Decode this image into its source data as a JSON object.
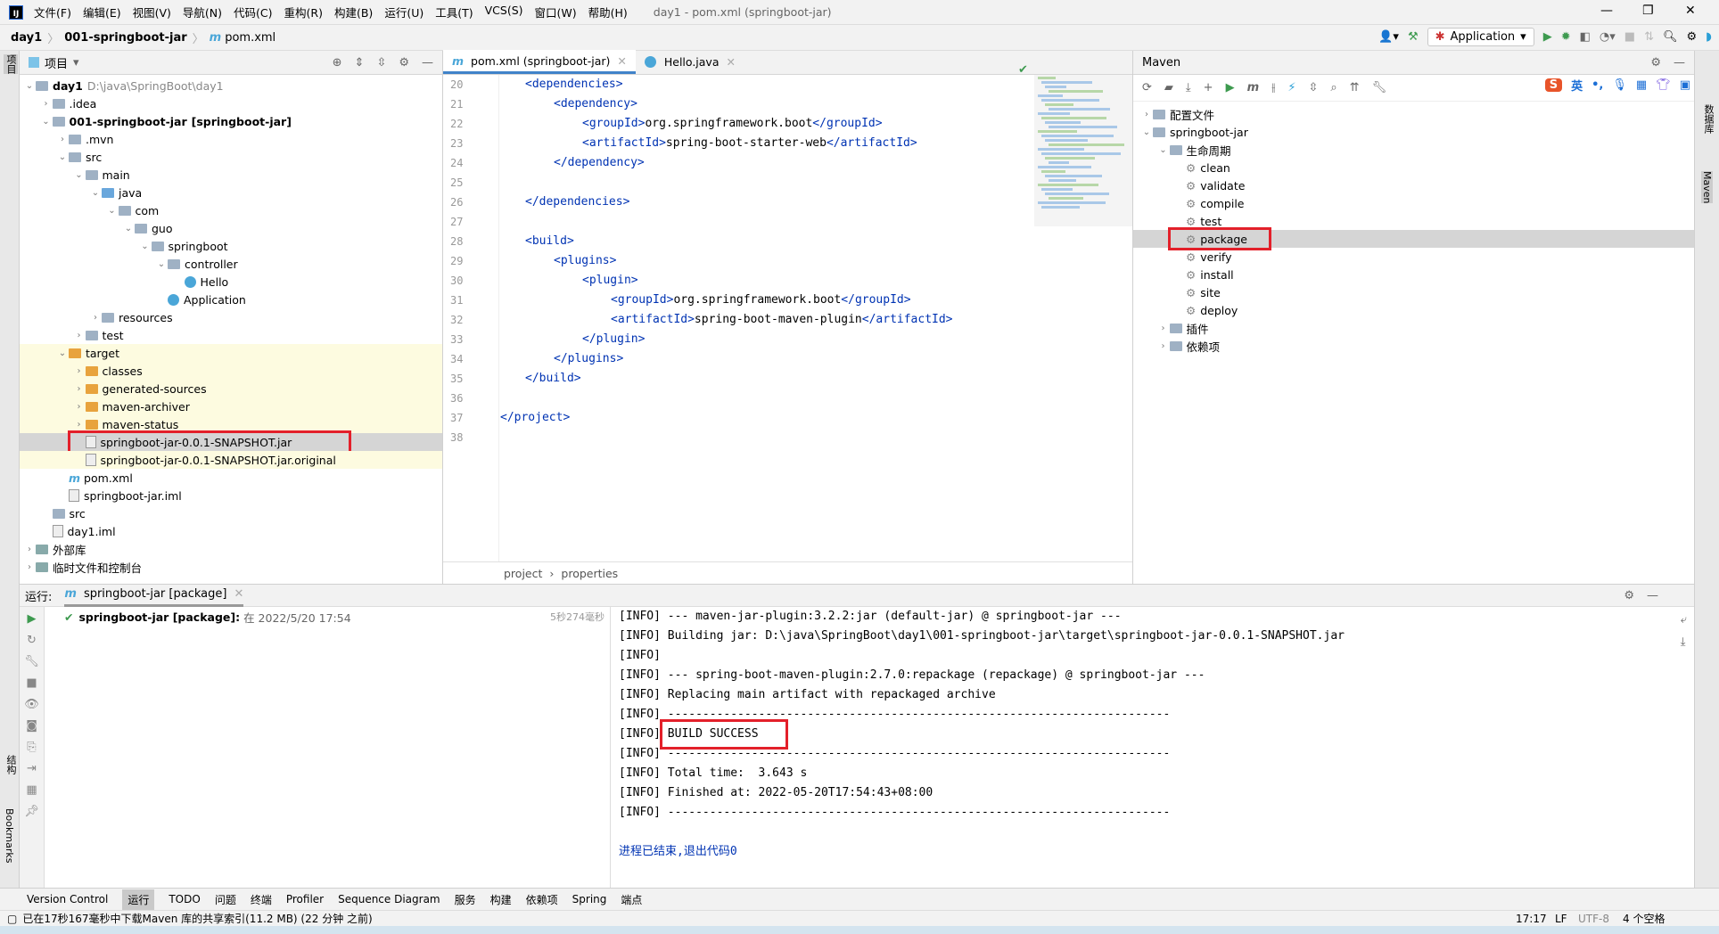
{
  "title_bar": {
    "menus": [
      "文件(F)",
      "编辑(E)",
      "视图(V)",
      "导航(N)",
      "代码(C)",
      "重构(R)",
      "构建(B)",
      "运行(U)",
      "工具(T)",
      "VCS(S)",
      "窗口(W)",
      "帮助(H)"
    ],
    "window_title": "day1 - pom.xml (springboot-jar)"
  },
  "nav": {
    "breadcrumbs": [
      "day1",
      "001-springboot-jar",
      "pom.xml"
    ],
    "run_config": "Application"
  },
  "left_stripe": {
    "project_label": "项目",
    "structure_label": "结构",
    "bookmarks_label": "Bookmarks"
  },
  "right_stripe": {
    "db_label": "数据库",
    "maven_label": "Maven"
  },
  "project": {
    "title": "项目",
    "tree": [
      {
        "label": "day1",
        "extra": "D:\\java\\SpringBoot\\day1",
        "level": 0,
        "state": "open",
        "icon": "module",
        "bold": true
      },
      {
        "label": ".idea",
        "level": 1,
        "state": "closed",
        "icon": "folder"
      },
      {
        "label": "001-springboot-jar",
        "extra": "[springboot-jar]",
        "level": 1,
        "state": "open",
        "icon": "module",
        "bold": true,
        "extra_bold": true
      },
      {
        "label": ".mvn",
        "level": 2,
        "state": "closed",
        "icon": "folder"
      },
      {
        "label": "src",
        "level": 2,
        "state": "open",
        "icon": "folder"
      },
      {
        "label": "main",
        "level": 3,
        "state": "open",
        "icon": "folder"
      },
      {
        "label": "java",
        "level": 4,
        "state": "open",
        "icon": "folder-src"
      },
      {
        "label": "com",
        "level": 5,
        "state": "open",
        "icon": "package"
      },
      {
        "label": "guo",
        "level": 6,
        "state": "open",
        "icon": "package"
      },
      {
        "label": "springboot",
        "level": 7,
        "state": "open",
        "icon": "package"
      },
      {
        "label": "controller",
        "level": 8,
        "state": "open",
        "icon": "package"
      },
      {
        "label": "Hello",
        "level": 9,
        "state": "leaf",
        "icon": "class"
      },
      {
        "label": "Application",
        "level": 8,
        "state": "leaf",
        "icon": "class"
      },
      {
        "label": "resources",
        "level": 4,
        "state": "closed",
        "icon": "folder"
      },
      {
        "label": "test",
        "level": 3,
        "state": "closed",
        "icon": "folder"
      },
      {
        "label": "target",
        "level": 2,
        "state": "open",
        "icon": "folder-excluded",
        "hl": true
      },
      {
        "label": "classes",
        "level": 3,
        "state": "closed",
        "icon": "folder-excluded",
        "hl": true
      },
      {
        "label": "generated-sources",
        "level": 3,
        "state": "closed",
        "icon": "folder-excluded",
        "hl": true
      },
      {
        "label": "maven-archiver",
        "level": 3,
        "state": "closed",
        "icon": "folder-excluded",
        "hl": true
      },
      {
        "label": "maven-status",
        "level": 3,
        "state": "closed",
        "icon": "folder-excluded",
        "hl": true
      },
      {
        "label": "springboot-jar-0.0.1-SNAPSHOT.jar",
        "level": 3,
        "state": "leaf",
        "icon": "jar",
        "selected": true,
        "boxed": true
      },
      {
        "label": "springboot-jar-0.0.1-SNAPSHOT.jar.original",
        "level": 3,
        "state": "leaf",
        "icon": "file",
        "hl": true
      },
      {
        "label": "pom.xml",
        "level": 2,
        "state": "leaf",
        "icon": "maven"
      },
      {
        "label": "springboot-jar.iml",
        "level": 2,
        "state": "leaf",
        "icon": "file"
      },
      {
        "label": "src",
        "level": 1,
        "state": "leaf",
        "icon": "folder"
      },
      {
        "label": "day1.iml",
        "level": 1,
        "state": "leaf",
        "icon": "file"
      },
      {
        "label": "外部库",
        "level": 0,
        "state": "closed",
        "icon": "library"
      },
      {
        "label": "临时文件和控制台",
        "level": 0,
        "state": "closed",
        "icon": "scratch"
      }
    ]
  },
  "editor": {
    "tabs": [
      {
        "label": "pom.xml (springboot-jar)",
        "icon": "maven",
        "active": true
      },
      {
        "label": "Hello.java",
        "icon": "class",
        "active": false
      }
    ],
    "lines": [
      {
        "n": "20",
        "indent": 1,
        "parts": [
          [
            "t",
            "<dependencies>"
          ]
        ]
      },
      {
        "n": "21",
        "indent": 2,
        "parts": [
          [
            "t",
            "<dependency>"
          ]
        ]
      },
      {
        "n": "22",
        "indent": 3,
        "parts": [
          [
            "t",
            "<groupId>"
          ],
          [
            "x",
            "org.springframework.boot"
          ],
          [
            "t",
            "</groupId>"
          ]
        ]
      },
      {
        "n": "23",
        "indent": 3,
        "parts": [
          [
            "t",
            "<artifactId>"
          ],
          [
            "x",
            "spring-boot-starter-web"
          ],
          [
            "t",
            "</artifactId>"
          ]
        ]
      },
      {
        "n": "24",
        "indent": 2,
        "parts": [
          [
            "t",
            "</dependency>"
          ]
        ]
      },
      {
        "n": "25",
        "indent": 0,
        "parts": []
      },
      {
        "n": "26",
        "indent": 1,
        "parts": [
          [
            "t",
            "</dependencies>"
          ]
        ]
      },
      {
        "n": "27",
        "indent": 0,
        "parts": []
      },
      {
        "n": "28",
        "indent": 1,
        "parts": [
          [
            "t",
            "<build>"
          ]
        ]
      },
      {
        "n": "29",
        "indent": 2,
        "parts": [
          [
            "t",
            "<plugins>"
          ]
        ]
      },
      {
        "n": "30",
        "indent": 3,
        "parts": [
          [
            "t",
            "<plugin>"
          ]
        ]
      },
      {
        "n": "31",
        "indent": 4,
        "parts": [
          [
            "t",
            "<groupId>"
          ],
          [
            "x",
            "org.springframework.boot"
          ],
          [
            "t",
            "</groupId>"
          ]
        ]
      },
      {
        "n": "32",
        "indent": 4,
        "parts": [
          [
            "t",
            "<artifactId>"
          ],
          [
            "x",
            "spring-boot-maven-plugin"
          ],
          [
            "t",
            "</artifactId>"
          ]
        ]
      },
      {
        "n": "33",
        "indent": 3,
        "parts": [
          [
            "t",
            "</plugin>"
          ]
        ]
      },
      {
        "n": "34",
        "indent": 2,
        "parts": [
          [
            "t",
            "</plugins>"
          ]
        ]
      },
      {
        "n": "35",
        "indent": 1,
        "parts": [
          [
            "t",
            "</build>"
          ]
        ]
      },
      {
        "n": "36",
        "indent": 0,
        "parts": []
      },
      {
        "n": "37",
        "indent": 0,
        "parts": [
          [
            "t",
            "</project>"
          ]
        ]
      },
      {
        "n": "38",
        "indent": 0,
        "parts": []
      }
    ],
    "breadcrumb": [
      "project",
      "properties"
    ]
  },
  "maven": {
    "title": "Maven",
    "tree": [
      {
        "label": "配置文件",
        "level": 0,
        "state": "closed",
        "icon": "folder"
      },
      {
        "label": "springboot-jar",
        "level": 0,
        "state": "open",
        "icon": "module"
      },
      {
        "label": "生命周期",
        "level": 1,
        "state": "open",
        "icon": "folder"
      },
      {
        "label": "clean",
        "level": 2,
        "state": "leaf",
        "icon": "gear"
      },
      {
        "label": "validate",
        "level": 2,
        "state": "leaf",
        "icon": "gear"
      },
      {
        "label": "compile",
        "level": 2,
        "state": "leaf",
        "icon": "gear"
      },
      {
        "label": "test",
        "level": 2,
        "state": "leaf",
        "icon": "gear"
      },
      {
        "label": "package",
        "level": 2,
        "state": "leaf",
        "icon": "gear",
        "selected": true,
        "boxed": true
      },
      {
        "label": "verify",
        "level": 2,
        "state": "leaf",
        "icon": "gear"
      },
      {
        "label": "install",
        "level": 2,
        "state": "leaf",
        "icon": "gear"
      },
      {
        "label": "site",
        "level": 2,
        "state": "leaf",
        "icon": "gear"
      },
      {
        "label": "deploy",
        "level": 2,
        "state": "leaf",
        "icon": "gear"
      },
      {
        "label": "插件",
        "level": 1,
        "state": "closed",
        "icon": "folder"
      },
      {
        "label": "依赖项",
        "level": 1,
        "state": "closed",
        "icon": "folder"
      }
    ],
    "ime": [
      "英",
      "•,"
    ]
  },
  "run": {
    "label": "运行:",
    "tab": "springboot-jar [package]",
    "item_name": "springboot-jar [package]:",
    "item_time": "在 2022/5/20 17:54",
    "duration": "5秒274毫秒",
    "console": [
      "[INFO] --- maven-jar-plugin:3.2.2:jar (default-jar) @ springboot-jar ---",
      "[INFO] Building jar: D:\\java\\SpringBoot\\day1\\001-springboot-jar\\target\\springboot-jar-0.0.1-SNAPSHOT.jar",
      "[INFO]",
      "[INFO] --- spring-boot-maven-plugin:2.7.0:repackage (repackage) @ springboot-jar ---",
      "[INFO] Replacing main artifact with repackaged archive",
      "[INFO] ------------------------------------------------------------------------",
      "[INFO] BUILD SUCCESS",
      "[INFO] ------------------------------------------------------------------------",
      "[INFO] Total time:  3.643 s",
      "[INFO] Finished at: 2022-05-20T17:54:43+08:00",
      "[INFO] ------------------------------------------------------------------------",
      "",
      "进程已结束,退出代码0"
    ]
  },
  "toolwindows": [
    "Version Control",
    "运行",
    "TODO",
    "问题",
    "终端",
    "Profiler",
    "Sequence Diagram",
    "服务",
    "构建",
    "依赖项",
    "Spring",
    "端点"
  ],
  "status": {
    "message": "已在17秒167毫秒中下载Maven 库的共享索引(11.2 MB) (22 分钟 之前)",
    "position": "17:17",
    "line_sep": "LF",
    "encoding": "UTF-8",
    "indent": "4 个空格"
  },
  "colors": {
    "accent": "#4083c9",
    "highlight_box": "#e3202a",
    "excluded_bg": "#fdfbe0",
    "xml_tag": "#0033b3"
  }
}
